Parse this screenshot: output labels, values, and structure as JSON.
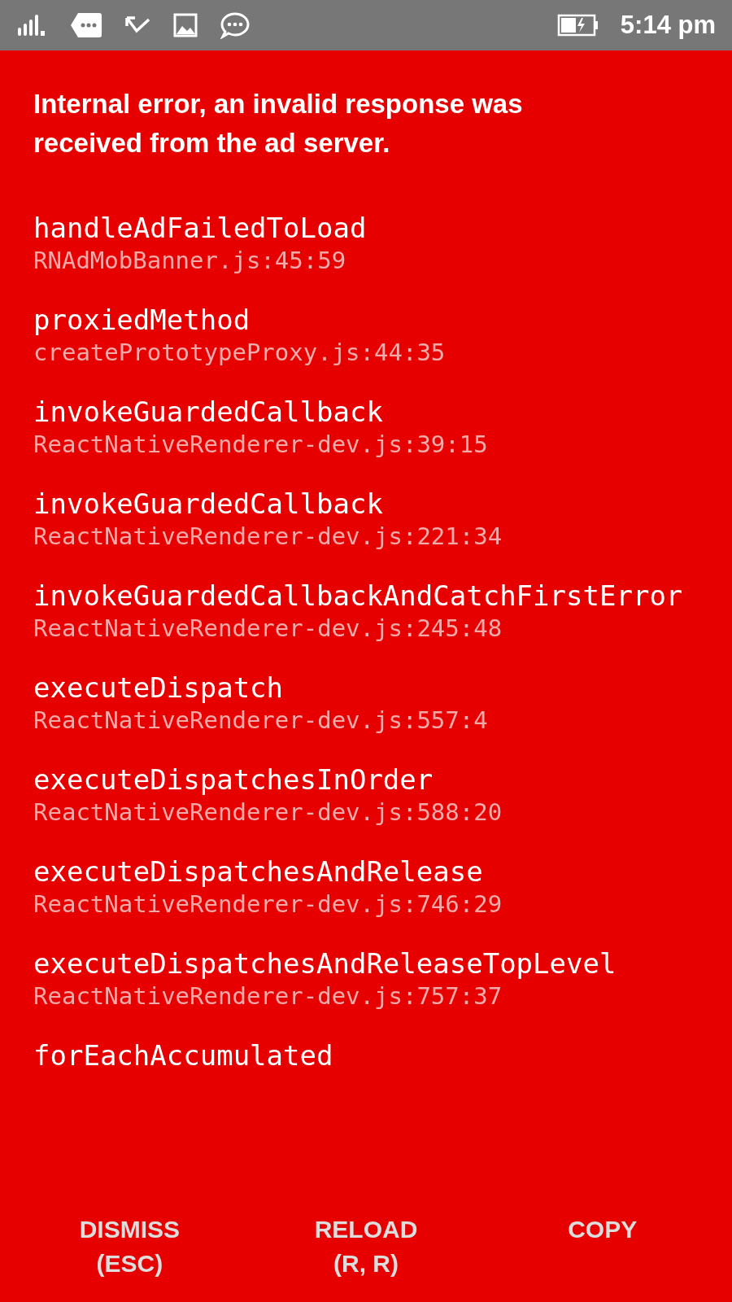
{
  "status_bar": {
    "time": "5:14 pm"
  },
  "error": {
    "message": "Internal error, an invalid response was received from the ad server."
  },
  "stack": [
    {
      "method": "handleAdFailedToLoad",
      "location": "RNAdMobBanner.js:45:59"
    },
    {
      "method": "proxiedMethod",
      "location": "createPrototypeProxy.js:44:35"
    },
    {
      "method": "invokeGuardedCallback",
      "location": "ReactNativeRenderer-dev.js:39:15"
    },
    {
      "method": "invokeGuardedCallback",
      "location": "ReactNativeRenderer-dev.js:221:34"
    },
    {
      "method": "invokeGuardedCallbackAndCatchFirstError",
      "location": "ReactNativeRenderer-dev.js:245:48"
    },
    {
      "method": "executeDispatch",
      "location": "ReactNativeRenderer-dev.js:557:4"
    },
    {
      "method": "executeDispatchesInOrder",
      "location": "ReactNativeRenderer-dev.js:588:20"
    },
    {
      "method": "executeDispatchesAndRelease",
      "location": "ReactNativeRenderer-dev.js:746:29"
    },
    {
      "method": "executeDispatchesAndReleaseTopLevel",
      "location": "ReactNativeRenderer-dev.js:757:37"
    },
    {
      "method": "forEachAccumulated"
    }
  ],
  "buttons": [
    {
      "label": "DISMISS",
      "shortcut": "(ESC)"
    },
    {
      "label": "RELOAD",
      "shortcut": "(R, R)"
    },
    {
      "label": "COPY"
    }
  ]
}
